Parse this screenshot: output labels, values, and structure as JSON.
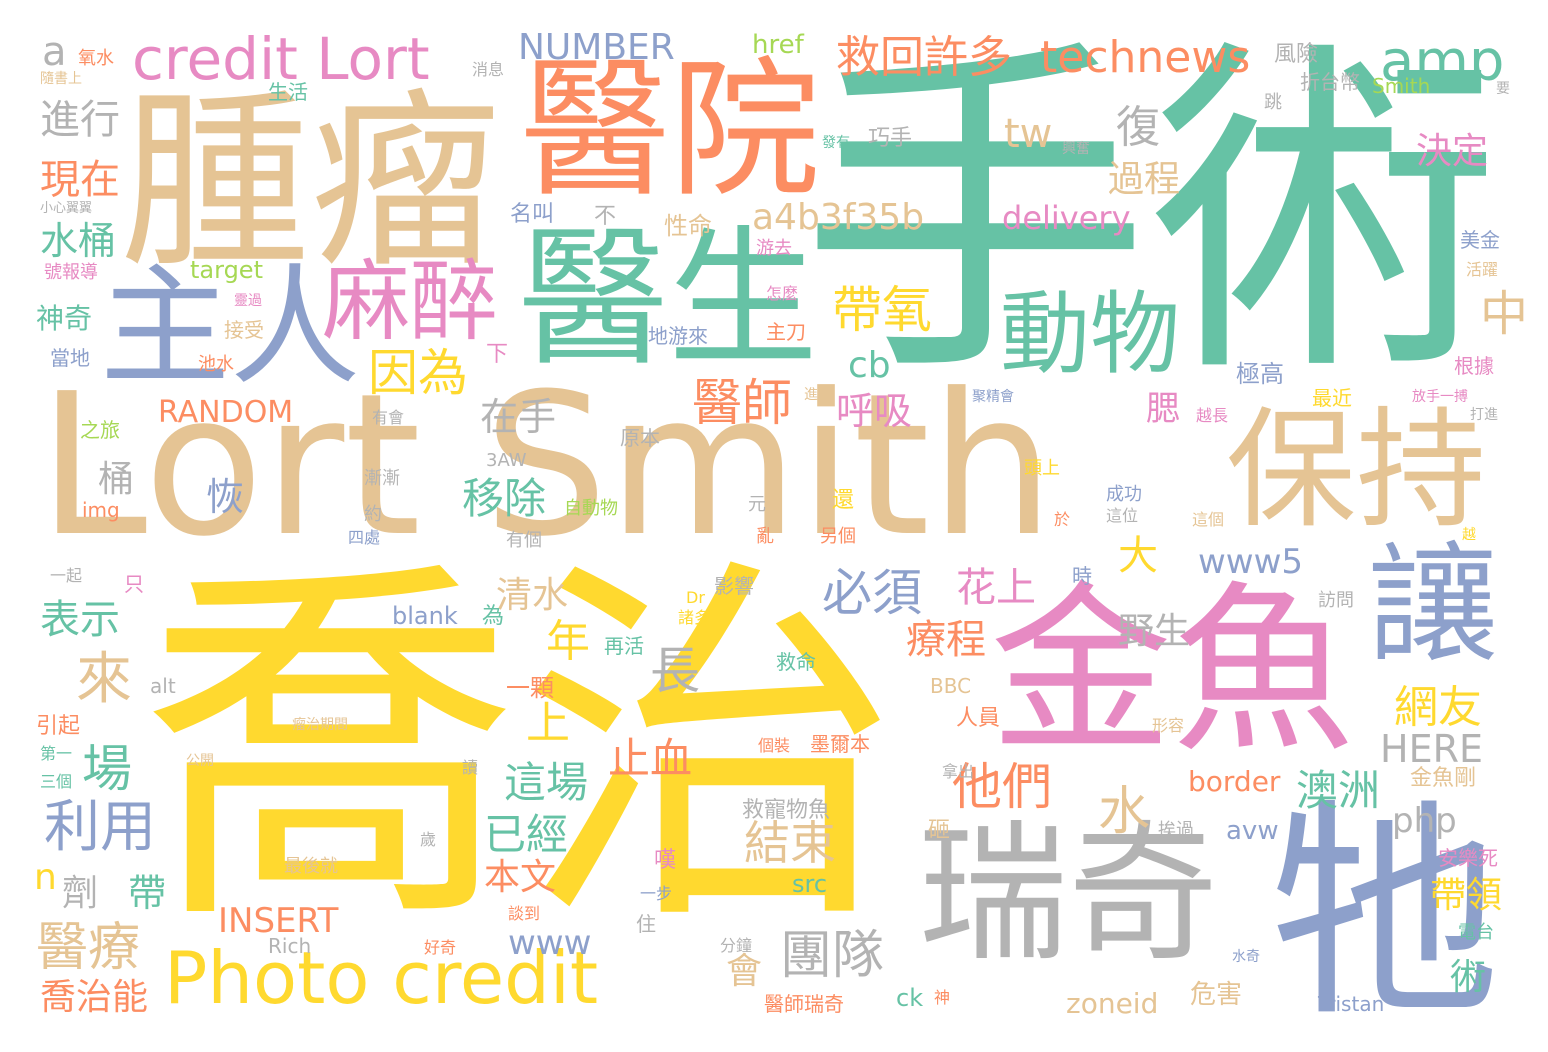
{
  "palette": {
    "yellow": "#ffd92f",
    "tan": "#e5c494",
    "teal": "#66c2a5",
    "orange": "#fc8d62",
    "blue": "#8da0cb",
    "pink": "#e78ac3",
    "green": "#a6d854",
    "gray": "#b3b3b3"
  },
  "words": [
    {
      "text": "手術",
      "color": "#66c2a5"
    },
    {
      "text": "喬治",
      "color": "#ffd92f"
    },
    {
      "text": "Lort Smith",
      "color": "#e5c494"
    },
    {
      "text": "腫瘤",
      "color": "#e5c494"
    },
    {
      "text": "醫院",
      "color": "#fc8d62"
    },
    {
      "text": "醫生",
      "color": "#66c2a5"
    },
    {
      "text": "金魚",
      "color": "#e78ac3"
    },
    {
      "text": "牠",
      "color": "#8da0cb"
    },
    {
      "text": "瑞奇",
      "color": "#b3b3b3"
    },
    {
      "text": "主人",
      "color": "#8da0cb"
    },
    {
      "text": "讓",
      "color": "#8da0cb"
    },
    {
      "text": "保持",
      "color": "#e5c494"
    },
    {
      "text": "麻醉",
      "color": "#e78ac3"
    },
    {
      "text": "動物",
      "color": "#66c2a5"
    },
    {
      "text": "Photo credit",
      "color": "#ffd92f"
    },
    {
      "text": "credit Lort",
      "color": "#e78ac3"
    },
    {
      "text": "amp",
      "color": "#66c2a5"
    },
    {
      "text": "救回許多",
      "color": "#fc8d62"
    },
    {
      "text": "technews",
      "color": "#fc8d62"
    },
    {
      "text": "NUMBER",
      "color": "#8da0cb"
    },
    {
      "text": "a4b3f35b",
      "color": "#e5c494"
    },
    {
      "text": "delivery",
      "color": "#e78ac3"
    },
    {
      "text": "RANDOM",
      "color": "#fc8d62"
    },
    {
      "text": "因為",
      "color": "#ffd92f"
    },
    {
      "text": "帶氧",
      "color": "#ffd92f"
    },
    {
      "text": "醫師",
      "color": "#fc8d62"
    },
    {
      "text": "呼吸",
      "color": "#e78ac3"
    },
    {
      "text": "必須",
      "color": "#8da0cb"
    },
    {
      "text": "移除",
      "color": "#66c2a5"
    },
    {
      "text": "www5",
      "color": "#8da0cb"
    },
    {
      "text": "他們",
      "color": "#fc8d62"
    },
    {
      "text": "利用",
      "color": "#8da0cb"
    },
    {
      "text": "醫療",
      "color": "#e5c494"
    },
    {
      "text": "團隊",
      "color": "#b3b3b3"
    },
    {
      "text": "結束",
      "color": "#e5c494"
    },
    {
      "text": "這場",
      "color": "#66c2a5"
    },
    {
      "text": "已經",
      "color": "#66c2a5"
    },
    {
      "text": "止血",
      "color": "#fc8d62"
    },
    {
      "text": "網友",
      "color": "#ffd92f"
    },
    {
      "text": "澳洲",
      "color": "#66c2a5"
    },
    {
      "text": "帶領",
      "color": "#ffd92f"
    },
    {
      "text": "決定",
      "color": "#e78ac3"
    },
    {
      "text": "過程",
      "color": "#e5c494"
    },
    {
      "text": "現在",
      "color": "#fc8d62"
    },
    {
      "text": "進行",
      "color": "#b3b3b3"
    },
    {
      "text": "水桶",
      "color": "#66c2a5"
    },
    {
      "text": "神奇",
      "color": "#66c2a5"
    },
    {
      "text": "表示",
      "color": "#66c2a5"
    },
    {
      "text": "喬治能",
      "color": "#fc8d62"
    },
    {
      "text": "療程",
      "color": "#fc8d62"
    },
    {
      "text": "花上",
      "color": "#e78ac3"
    },
    {
      "text": "野生",
      "color": "#b3b3b3"
    },
    {
      "text": "清水",
      "color": "#e5c494"
    },
    {
      "text": "在手",
      "color": "#b3b3b3"
    },
    {
      "text": "INSERT",
      "color": "#fc8d62"
    },
    {
      "text": "HERE",
      "color": "#b3b3b3"
    },
    {
      "text": "php",
      "color": "#b3b3b3"
    },
    {
      "text": "www",
      "color": "#8da0cb"
    },
    {
      "text": "本文",
      "color": "#fc8d62"
    },
    {
      "text": "水",
      "color": "#e5c494"
    },
    {
      "text": "來",
      "color": "#e5c494"
    },
    {
      "text": "場",
      "color": "#66c2a5"
    },
    {
      "text": "年",
      "color": "#ffd92f"
    },
    {
      "text": "長",
      "color": "#b3b3b3"
    },
    {
      "text": "上",
      "color": "#ffd92f"
    },
    {
      "text": "復",
      "color": "#b3b3b3"
    },
    {
      "text": "中",
      "color": "#e5c494"
    },
    {
      "text": "tw",
      "color": "#e5c494"
    },
    {
      "text": "cb",
      "color": "#66c2a5"
    },
    {
      "text": "大",
      "color": "#ffd92f"
    },
    {
      "text": "a",
      "color": "#b3b3b3"
    },
    {
      "text": "n",
      "color": "#ffd92f"
    },
    {
      "text": "帶",
      "color": "#66c2a5"
    },
    {
      "text": "恢",
      "color": "#8da0cb"
    },
    {
      "text": "桶",
      "color": "#b3b3b3"
    },
    {
      "text": "腮",
      "color": "#e78ac3"
    },
    {
      "text": "會",
      "color": "#e5c494"
    },
    {
      "text": "術",
      "color": "#66c2a5"
    },
    {
      "text": "劑",
      "color": "#b3b3b3"
    },
    {
      "text": "危害",
      "color": "#e5c494"
    },
    {
      "text": "一顆",
      "color": "#fc8d62"
    },
    {
      "text": "風險",
      "color": "#b3b3b3"
    },
    {
      "text": "巧手",
      "color": "#b3b3b3"
    },
    {
      "text": "折台幣",
      "color": "#b3b3b3"
    },
    {
      "text": "生活",
      "color": "#66c2a5"
    },
    {
      "text": "氧水",
      "color": "#fc8d62"
    },
    {
      "text": "消息",
      "color": "#b3b3b3"
    },
    {
      "text": "隨書上",
      "color": "#e5c494"
    },
    {
      "text": "名叫",
      "color": "#8da0cb"
    },
    {
      "text": "不",
      "color": "#b3b3b3"
    },
    {
      "text": "性命",
      "color": "#e5c494"
    },
    {
      "text": "游去",
      "color": "#e78ac3"
    },
    {
      "text": "小心翼翼",
      "color": "#b3b3b3"
    },
    {
      "text": "號報導",
      "color": "#e78ac3"
    },
    {
      "text": "target",
      "color": "#a6d854"
    },
    {
      "text": "接受",
      "color": "#e5c494"
    },
    {
      "text": "當地",
      "color": "#8da0cb"
    },
    {
      "text": "池水",
      "color": "#fc8d62"
    },
    {
      "text": "地游來",
      "color": "#8da0cb"
    },
    {
      "text": "主刀",
      "color": "#fc8d62"
    },
    {
      "text": "怎麼",
      "color": "#e78ac3"
    },
    {
      "text": "下",
      "color": "#e78ac3"
    },
    {
      "text": "之旅",
      "color": "#a6d854"
    },
    {
      "text": "有會",
      "color": "#b3b3b3"
    },
    {
      "text": "原本",
      "color": "#b3b3b3"
    },
    {
      "text": "3AW",
      "color": "#b3b3b3"
    },
    {
      "text": "img",
      "color": "#fc8d62"
    },
    {
      "text": "漸漸",
      "color": "#b3b3b3"
    },
    {
      "text": "約",
      "color": "#b3b3b3"
    },
    {
      "text": "自動物",
      "color": "#a6d854"
    },
    {
      "text": "有個",
      "color": "#b3b3b3"
    },
    {
      "text": "四處",
      "color": "#8da0cb"
    },
    {
      "text": "一起",
      "color": "#b3b3b3"
    },
    {
      "text": "只",
      "color": "#e78ac3"
    },
    {
      "text": "blank",
      "color": "#8da0cb"
    },
    {
      "text": "為",
      "color": "#66c2a5"
    },
    {
      "text": "再活",
      "color": "#66c2a5"
    },
    {
      "text": "alt",
      "color": "#b3b3b3"
    },
    {
      "text": "救命",
      "color": "#66c2a5"
    },
    {
      "text": "BBC",
      "color": "#e5c494"
    },
    {
      "text": "人員",
      "color": "#fc8d62"
    },
    {
      "text": "引起",
      "color": "#fc8d62"
    },
    {
      "text": "第一",
      "color": "#66c2a5"
    },
    {
      "text": "三個",
      "color": "#66c2a5"
    },
    {
      "text": "公開",
      "color": "#e5c494"
    },
    {
      "text": "讀",
      "color": "#b3b3b3"
    },
    {
      "text": "救寵物魚",
      "color": "#b3b3b3"
    },
    {
      "text": "砸",
      "color": "#e5c494"
    },
    {
      "text": "歲",
      "color": "#b3b3b3"
    },
    {
      "text": "最後就",
      "color": "#e5c494"
    },
    {
      "text": "嘆",
      "color": "#e78ac3"
    },
    {
      "text": "一步",
      "color": "#8da0cb"
    },
    {
      "text": "住",
      "color": "#b3b3b3"
    },
    {
      "text": "談到",
      "color": "#fc8d62"
    },
    {
      "text": "Rich",
      "color": "#b3b3b3"
    },
    {
      "text": "好奇",
      "color": "#fc8d62"
    },
    {
      "text": "分鐘",
      "color": "#b3b3b3"
    },
    {
      "text": "醫師瑞奇",
      "color": "#fc8d62"
    },
    {
      "text": "神",
      "color": "#fc8d62"
    },
    {
      "text": "ck",
      "color": "#66c2a5"
    },
    {
      "text": "zoneid",
      "color": "#e5c494"
    },
    {
      "text": "Tristan",
      "color": "#8da0cb"
    },
    {
      "text": "水奇",
      "color": "#8da0cb"
    },
    {
      "text": "電台",
      "color": "#66c2a5"
    },
    {
      "text": "安樂死",
      "color": "#e78ac3"
    },
    {
      "text": "金魚剛",
      "color": "#e5c494"
    },
    {
      "text": "avw",
      "color": "#8da0cb"
    },
    {
      "text": "border",
      "color": "#fc8d62"
    },
    {
      "text": "挨過",
      "color": "#b3b3b3"
    },
    {
      "text": "src",
      "color": "#66c2a5"
    },
    {
      "text": "形容",
      "color": "#e5c494"
    },
    {
      "text": "墨爾本",
      "color": "#fc8d62"
    },
    {
      "text": "個裝",
      "color": "#fc8d62"
    },
    {
      "text": "拿出",
      "color": "#b3b3b3"
    },
    {
      "text": "影響",
      "color": "#b3b3b3"
    },
    {
      "text": "Dr",
      "color": "#ffd92f"
    },
    {
      "text": "諸多",
      "color": "#ffd92f"
    },
    {
      "text": "時",
      "color": "#8da0cb"
    },
    {
      "text": "訪問",
      "color": "#b3b3b3"
    },
    {
      "text": "亂",
      "color": "#fc8d62"
    },
    {
      "text": "另個",
      "color": "#fc8d62"
    },
    {
      "text": "元",
      "color": "#b3b3b3"
    },
    {
      "text": "還",
      "color": "#ffd92f"
    },
    {
      "text": "成功",
      "color": "#8da0cb"
    },
    {
      "text": "這位",
      "color": "#b3b3b3"
    },
    {
      "text": "這個",
      "color": "#e5c494"
    },
    {
      "text": "於",
      "color": "#fc8d62"
    },
    {
      "text": "越",
      "color": "#ffd92f"
    },
    {
      "text": "頭上",
      "color": "#ffd92f"
    },
    {
      "text": "越長",
      "color": "#e78ac3"
    },
    {
      "text": "打進",
      "color": "#b3b3b3"
    },
    {
      "text": "放手一搏",
      "color": "#e78ac3"
    },
    {
      "text": "最近",
      "color": "#ffd92f"
    },
    {
      "text": "根據",
      "color": "#e78ac3"
    },
    {
      "text": "活躍",
      "color": "#e5c494"
    },
    {
      "text": "美金",
      "color": "#8da0cb"
    },
    {
      "text": "極高",
      "color": "#8da0cb"
    },
    {
      "text": "跳",
      "color": "#b3b3b3"
    },
    {
      "text": "興奮",
      "color": "#b3b3b3"
    },
    {
      "text": "Smith",
      "color": "#a6d854"
    },
    {
      "text": "要",
      "color": "#b3b3b3"
    },
    {
      "text": "聚精會",
      "color": "#8da0cb"
    },
    {
      "text": "進",
      "color": "#e5c494"
    },
    {
      "text": "發有",
      "color": "#66c2a5"
    },
    {
      "text": "href",
      "color": "#a6d854"
    },
    {
      "text": "靈過",
      "color": "#e78ac3"
    },
    {
      "text": "瘤治期間",
      "color": "#e5c494"
    }
  ]
}
